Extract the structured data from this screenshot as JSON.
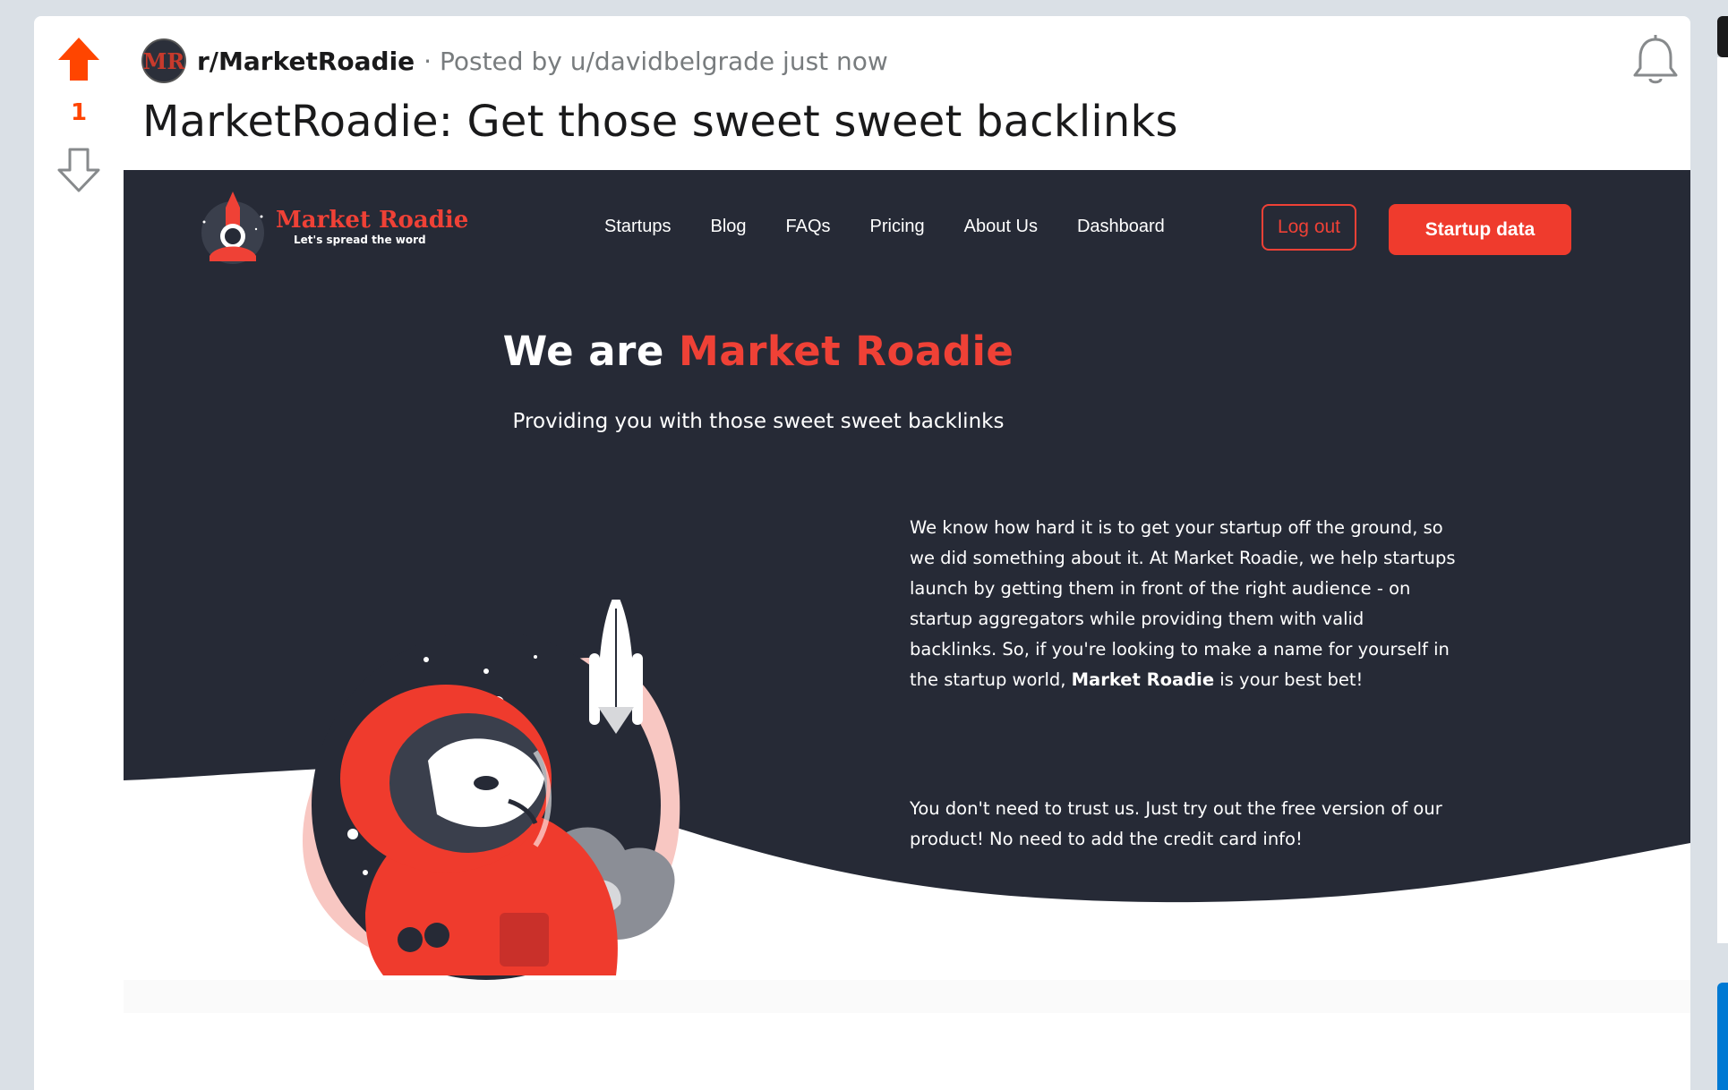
{
  "post": {
    "vote_count": "1",
    "subreddit": "r/MarketRoadie",
    "subreddit_avatar_text": "MR",
    "meta": "· Posted by u/davidbelgrade just now",
    "title": "MarketRoadie: Get those sweet sweet backlinks"
  },
  "site": {
    "logo_name": "Market Roadie",
    "logo_tagline": "Let's spread the word",
    "nav": [
      "Startups",
      "Blog",
      "FAQs",
      "Pricing",
      "About Us",
      "Dashboard"
    ],
    "logout_label": "Log out",
    "startup_data_label": "Startup data",
    "hero_title_prefix": "We are ",
    "hero_title_accent": "Market Roadie",
    "hero_subtitle": "Providing you with those sweet sweet backlinks",
    "about_text_before": "We know how hard it is to get your startup off the ground, so we did something about it. At Market Roadie, we help startups launch by getting them in front of the right audience - on startup aggregators while providing them with valid backlinks. So, if you're looking to make a name for yourself in the startup world, ",
    "about_text_bold": "Market Roadie",
    "about_text_after": " is your best bet!",
    "trust_text": "You don't need to trust us. Just try out the free version of our product! No need to add the credit card info!"
  },
  "colors": {
    "upvote": "#ff4500",
    "brand_red": "#ef4136",
    "site_dark": "#262a36",
    "page_bg": "#dae0e6"
  },
  "icons": [
    "upvote-icon",
    "downvote-icon",
    "bell-icon",
    "rocket-icon",
    "astronaut-icon"
  ]
}
